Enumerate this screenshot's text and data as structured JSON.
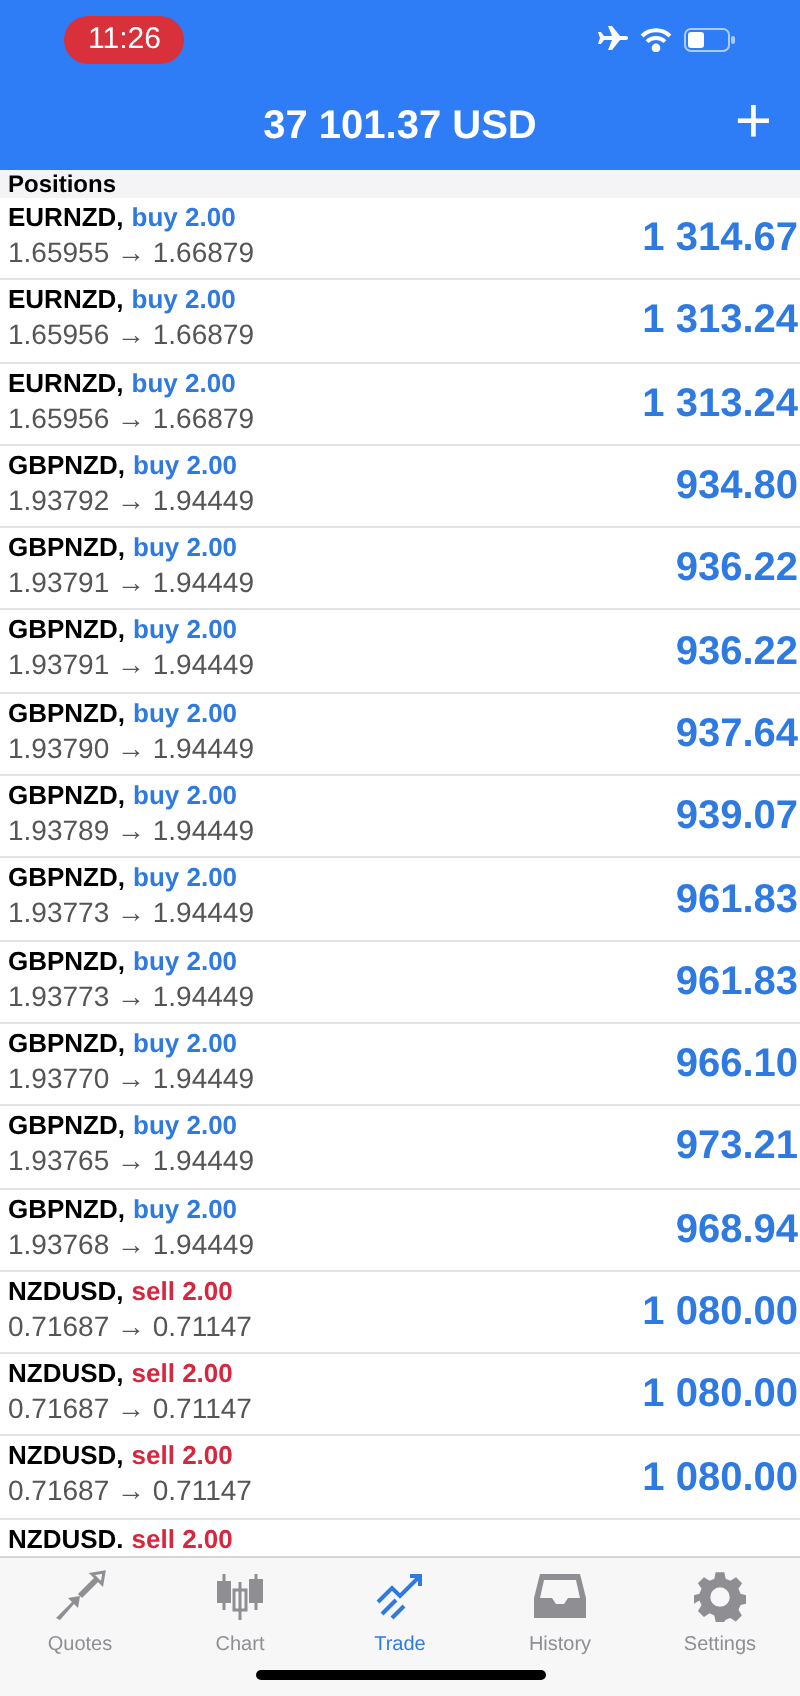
{
  "status_bar": {
    "time": "11:26"
  },
  "header": {
    "title": "37 101.37 USD",
    "add": "+"
  },
  "section": {
    "title": "Positions"
  },
  "positions": [
    {
      "symbol": "EURNZD,",
      "kind": "buy",
      "action": "buy 2.00",
      "prices": "1.65955 → 1.66879",
      "profit": "1 314.67"
    },
    {
      "symbol": "EURNZD,",
      "kind": "buy",
      "action": "buy 2.00",
      "prices": "1.65956 → 1.66879",
      "profit": "1 313.24"
    },
    {
      "symbol": "EURNZD,",
      "kind": "buy",
      "action": "buy 2.00",
      "prices": "1.65956 → 1.66879",
      "profit": "1 313.24"
    },
    {
      "symbol": "GBPNZD,",
      "kind": "buy",
      "action": "buy 2.00",
      "prices": "1.93792 → 1.94449",
      "profit": "934.80"
    },
    {
      "symbol": "GBPNZD,",
      "kind": "buy",
      "action": "buy 2.00",
      "prices": "1.93791 → 1.94449",
      "profit": "936.22"
    },
    {
      "symbol": "GBPNZD,",
      "kind": "buy",
      "action": "buy 2.00",
      "prices": "1.93791 → 1.94449",
      "profit": "936.22"
    },
    {
      "symbol": "GBPNZD,",
      "kind": "buy",
      "action": "buy 2.00",
      "prices": "1.93790 → 1.94449",
      "profit": "937.64"
    },
    {
      "symbol": "GBPNZD,",
      "kind": "buy",
      "action": "buy 2.00",
      "prices": "1.93789 → 1.94449",
      "profit": "939.07"
    },
    {
      "symbol": "GBPNZD,",
      "kind": "buy",
      "action": "buy 2.00",
      "prices": "1.93773 → 1.94449",
      "profit": "961.83"
    },
    {
      "symbol": "GBPNZD,",
      "kind": "buy",
      "action": "buy 2.00",
      "prices": "1.93773 → 1.94449",
      "profit": "961.83"
    },
    {
      "symbol": "GBPNZD,",
      "kind": "buy",
      "action": "buy 2.00",
      "prices": "1.93770 → 1.94449",
      "profit": "966.10"
    },
    {
      "symbol": "GBPNZD,",
      "kind": "buy",
      "action": "buy 2.00",
      "prices": "1.93765 → 1.94449",
      "profit": "973.21"
    },
    {
      "symbol": "GBPNZD,",
      "kind": "buy",
      "action": "buy 2.00",
      "prices": "1.93768 → 1.94449",
      "profit": "968.94"
    },
    {
      "symbol": "NZDUSD,",
      "kind": "sell",
      "action": "sell 2.00",
      "prices": "0.71687 → 0.71147",
      "profit": "1 080.00"
    },
    {
      "symbol": "NZDUSD,",
      "kind": "sell",
      "action": "sell 2.00",
      "prices": "0.71687 → 0.71147",
      "profit": "1 080.00"
    },
    {
      "symbol": "NZDUSD,",
      "kind": "sell",
      "action": "sell 2.00",
      "prices": "0.71687 → 0.71147",
      "profit": "1 080.00"
    },
    {
      "symbol": "NZDUSD.",
      "kind": "sell",
      "action": "sell 2.00"
    }
  ],
  "tabs": [
    {
      "label": "Quotes",
      "kind": "quotes",
      "selected": false
    },
    {
      "label": "Chart",
      "kind": "chart",
      "selected": false
    },
    {
      "label": "Trade",
      "kind": "trade",
      "selected": true
    },
    {
      "label": "History",
      "kind": "history",
      "selected": false
    },
    {
      "label": "Settings",
      "kind": "settings",
      "selected": false
    }
  ]
}
